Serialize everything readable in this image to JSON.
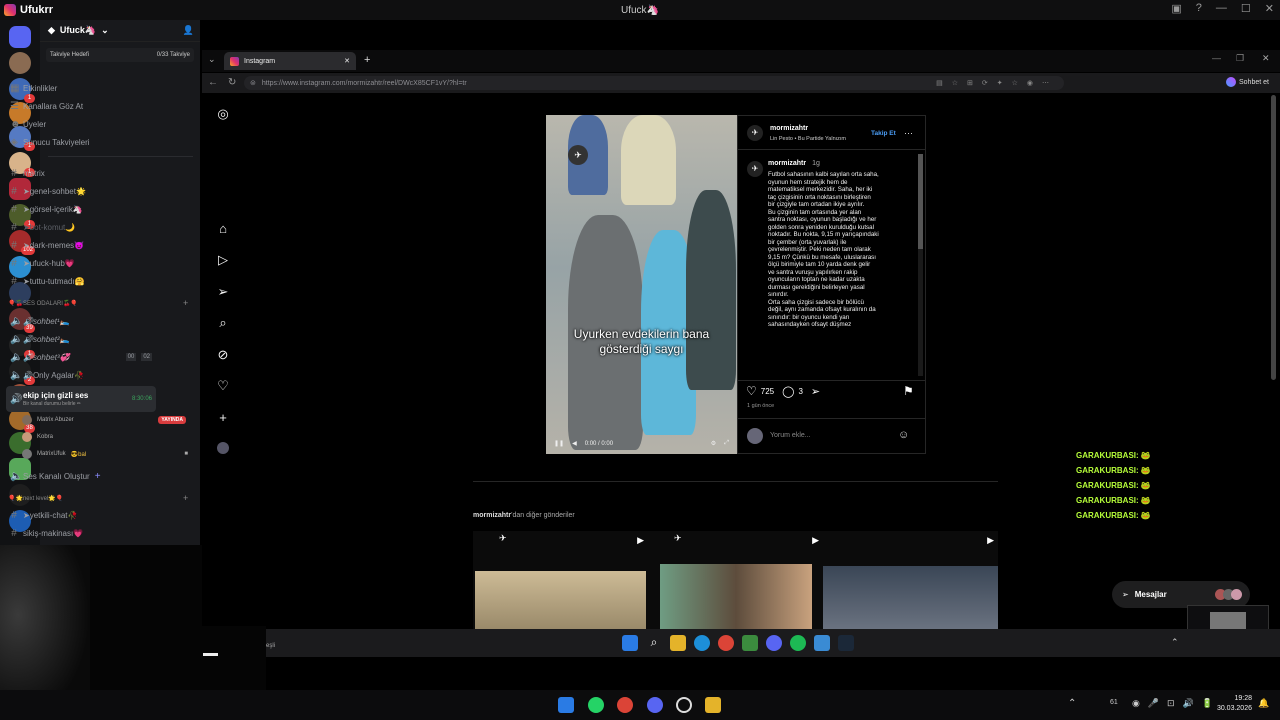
{
  "window": {
    "app_name": "Ufukrr",
    "center_title": "Ufuck🦄"
  },
  "discord": {
    "guild_name": "Ufuck🦄",
    "boost": {
      "label": "Takviye Hedefi",
      "count": "0/33 Takviye"
    },
    "top_items": [
      "Etkinlikler",
      "Kanallara Göz At",
      "Üyeler",
      "Sunucu Takviyeleri"
    ],
    "text_channels": [
      "matrix",
      "➤genel-sohbet🌟",
      "➤görsel-içerik🦄",
      "➤bot-komut🌙",
      "➤dark-memes😈",
      "➤ufuck-hub💗",
      "➤tuttu-tutmadı🤗"
    ],
    "voice_category": "🎈🍒SES ODALARI🍒🎈",
    "voice_channels": [
      "🔊sohbet¹🛌",
      "🔊sohbet²🛌",
      "🔊sohbet³💞",
      "🔊Only Agalar🥀"
    ],
    "voice_counts": [
      "00",
      "02"
    ],
    "active_voice": {
      "name": "ekip için gizli ses",
      "status": "Bir kanal durumu belirle ✏",
      "timer": "8:30:06"
    },
    "voice_users": [
      {
        "name": "Matrix Abuzer",
        "live": "YAYINDA"
      },
      {
        "name": "Kobra",
        "live": ""
      },
      {
        "name": "MatrixUfuk",
        "tag": "😎bal"
      }
    ],
    "create_voice": "Ses Kanalı Oluştur",
    "next_category": "🎈🌟next level🌟🎈",
    "more_channels": [
      "➤yetkili-chat🥀",
      "sikiş-makinası💗"
    ],
    "server_badges": [
      "1",
      "1",
      "1",
      "1",
      "2",
      "102",
      "39",
      "1",
      "2",
      "38"
    ]
  },
  "browser": {
    "tab_title": "Instagram",
    "url": "https://www.instagram.com/mormizahtr/reel/DWcX85CF1vY/?hl=tr",
    "right_label": "Sohbet et"
  },
  "post": {
    "username": "mormizahtr",
    "follow": "Takip Et",
    "music": "Lin Pesto • Bu Partide Yalnızım",
    "caption_user": "mormizahtr",
    "caption_time": "1g",
    "caption": "Futbol sahasının kalbi sayılan orta saha,\noyunun hem stratejik hem de\nmatematiksel merkezidir. Saha, her iki\ntaç çizgisinin orta noktasını birleştiren\nbir çizgiyle tam ortadan ikiye ayrılır.\nBu çizginin tam ortasında yer alan\nsantra noktası, oyunun başladığı ve her\ngolden sonra yeniden kurulduğu kutsal\nnoktadır. Bu nokta, 9,15 m yarıçapındaki\nbir çember (orta yuvarlak) ile\nçevrelenmiştir. Peki neden tam olarak\n9,15 m? Çünkü bu mesafe, uluslararası\nölçü birimiyle tam 10 yarda denk gelir\nve santra vuruşu yapılırken rakip\noyuncuların toptan ne kadar uzakta\ndurması gerektiğini belirleyen yasal\nsınırdır.\nOrta saha çizgisi sadece bir bölücü\ndeğil, aynı zamanda ofsayt kuralının da\nsınırıdır: bir oyuncu kendi yarı\nsahasındayken ofsayt düşmez",
    "video_caption": "Uyurken evdekilerin bana gösterdiği saygı",
    "video_time": "0:00 / 0:00",
    "likes": "725",
    "comments": "3",
    "age": "1 gün önce",
    "comment_placeholder": "Yorum ekle...",
    "more_posts_user": "mormizahtr",
    "more_posts_suffix": "'dan diğer gönderiler"
  },
  "overlay": {
    "lines": [
      "GARAKURBASI: 🐸",
      "GARAKURBASI: 🐸",
      "GARAKURBASI: 🐸",
      "GARAKURBASI: 🐸",
      "GARAKURBASI: 🐸"
    ]
  },
  "messages_button": "Mesajlar",
  "inner_taskbar_label": "eşli",
  "taskbar": {
    "time": "19:28",
    "date": "30.03.2026",
    "temp": "61"
  }
}
